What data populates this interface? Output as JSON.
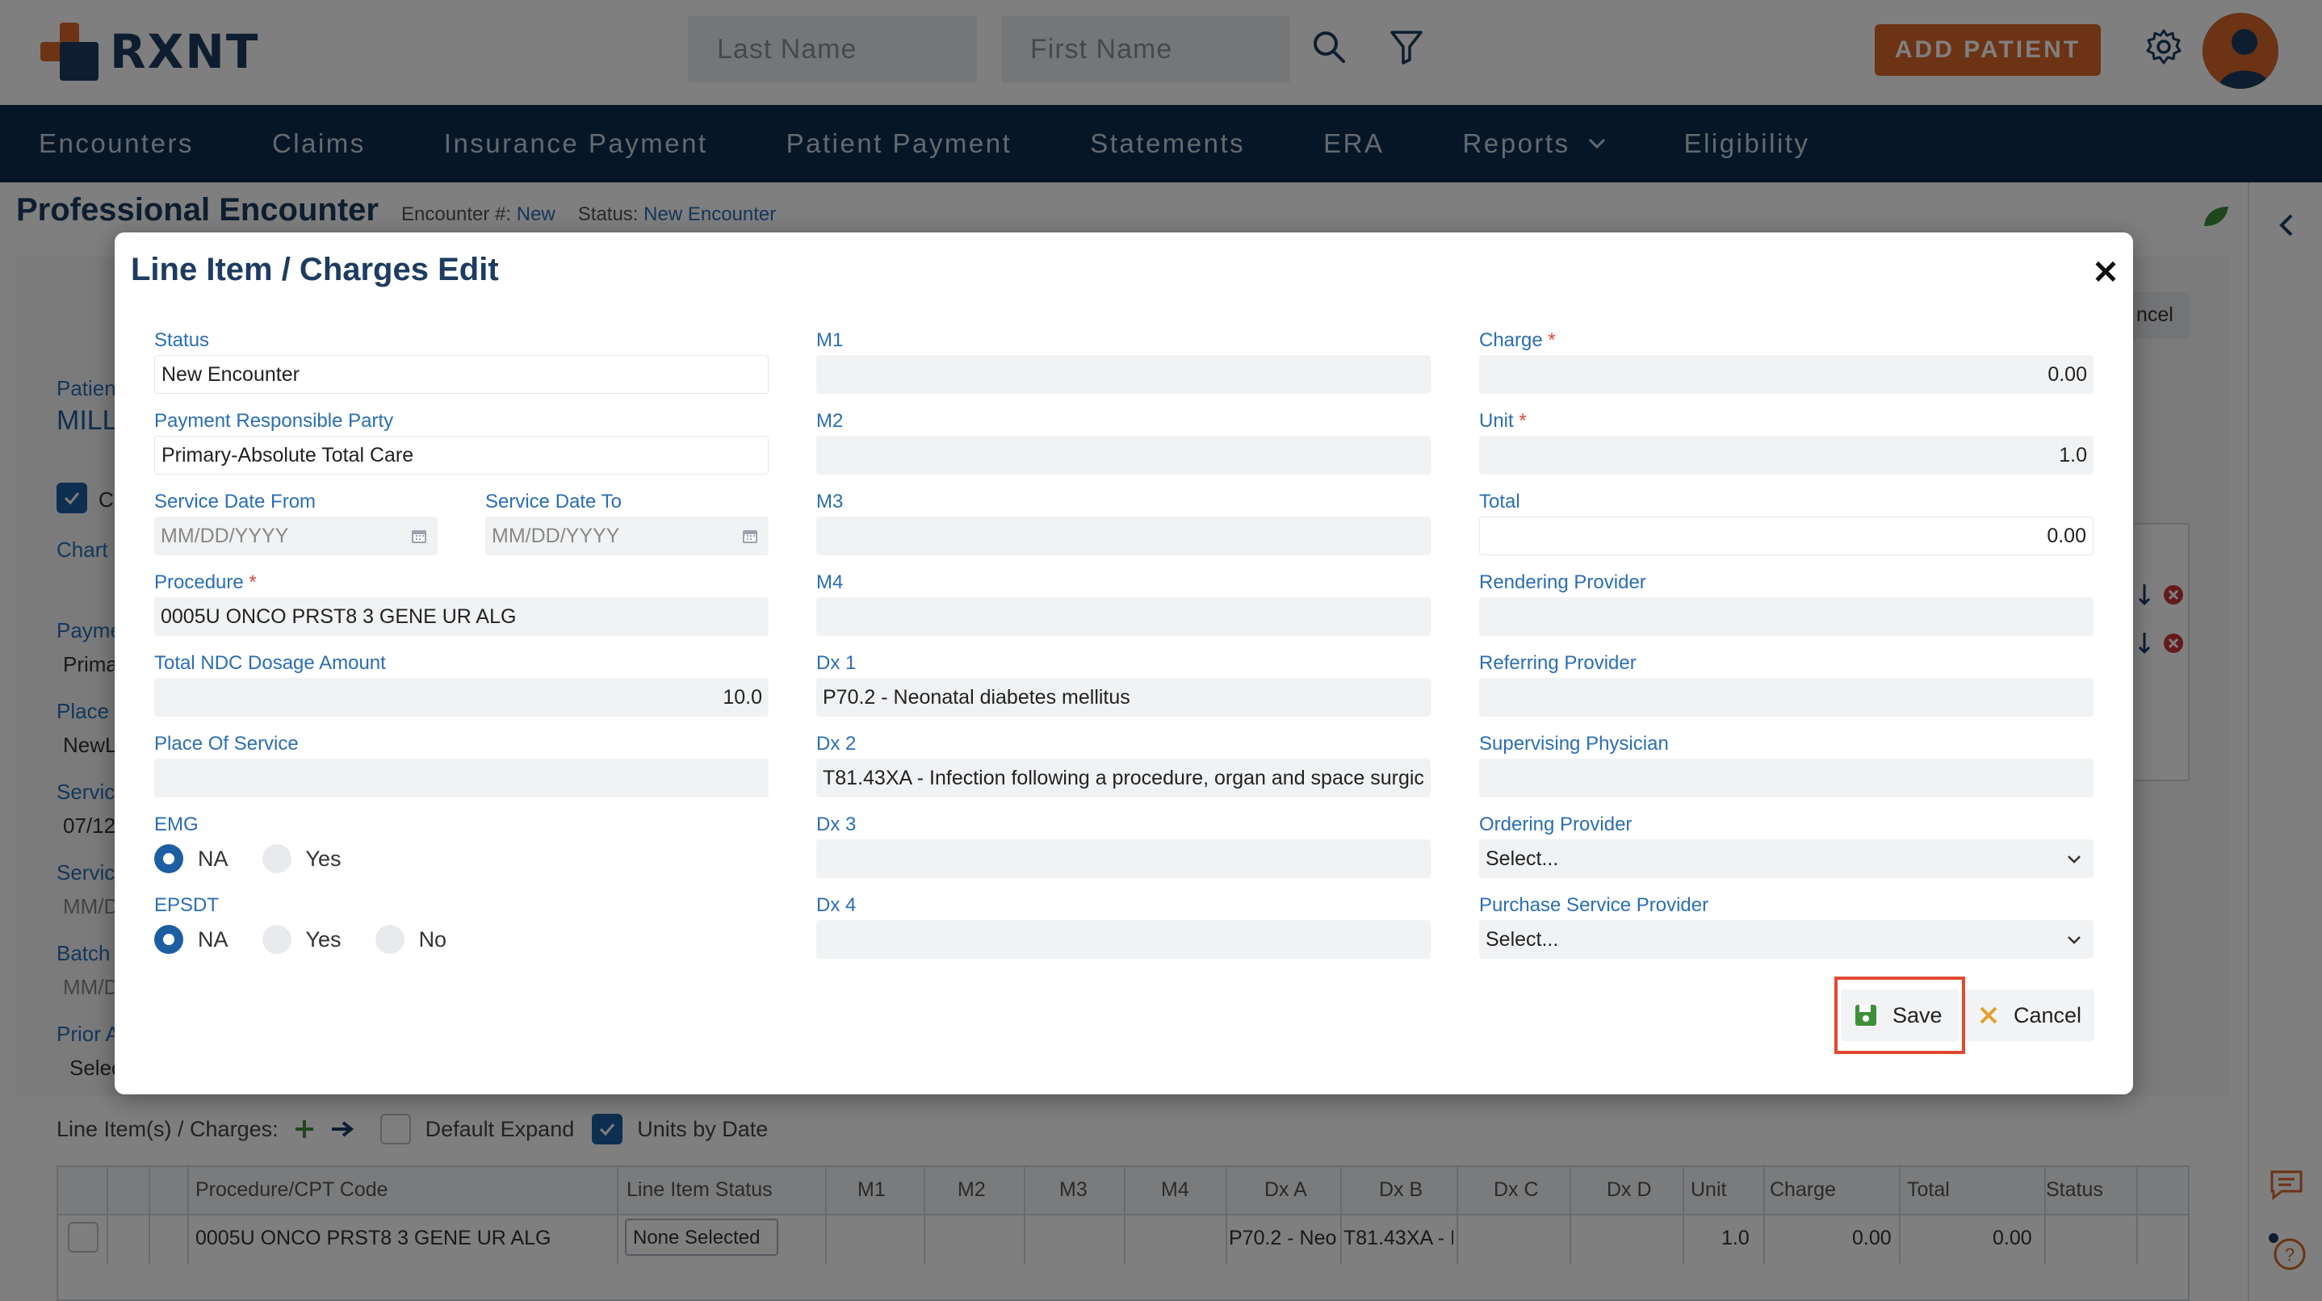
{
  "header": {
    "logo_text": "RXNT",
    "last_name_placeholder": "Last Name",
    "first_name_placeholder": "First Name",
    "add_patient_label": "ADD PATIENT",
    "brand_accent": "#d9662b",
    "brand_navy": "#0f2d4f"
  },
  "nav": {
    "items": [
      "Encounters",
      "Claims",
      "Insurance Payment",
      "Patient Payment",
      "Statements",
      "ERA",
      "Reports",
      "Eligibility"
    ]
  },
  "page": {
    "title": "Professional Encounter",
    "encounter_label": "Encounter #:",
    "encounter_value": "New",
    "status_label": "Status:",
    "status_value": "New Encounter",
    "cancel_label": "ncel",
    "side_fields": {
      "patient_label": "Patien",
      "patient_value": "MILL",
      "chart_label": "Chart",
      "check_label": "C",
      "payment_label": "Payme",
      "payment_value": "Prima",
      "place_label": "Place",
      "place_value": "NewL",
      "service1_label": "Servic",
      "service1_value": "07/12",
      "service2_label": "Servic",
      "service2_value": "MM/D",
      "batch_label": "Batch",
      "batch_value": "MM/D",
      "prior_label": "Prior A",
      "prior_value": "Selec"
    },
    "line_items": {
      "label": "Line Item(s) / Charges:",
      "default_expand": "Default Expand",
      "units_by_date": "Units by Date",
      "columns": [
        "Procedure/CPT Code",
        "Line Item Status",
        "M1",
        "M2",
        "M3",
        "M4",
        "Dx A",
        "Dx B",
        "Dx C",
        "Dx D",
        "Unit",
        "Charge",
        "Total",
        "Status"
      ],
      "row": {
        "procedure": "0005U ONCO PRST8 3 GENE UR ALG",
        "status_select": "None Selected",
        "dx_a": "P70.2 - Neor",
        "dx_b": "T81.43XA - I",
        "unit": "1.0",
        "charge": "0.00",
        "total": "0.00"
      }
    }
  },
  "modal": {
    "title": "Line Item / Charges Edit",
    "col1": {
      "status_label": "Status",
      "status_value": "New Encounter",
      "prp_label": "Payment Responsible Party",
      "prp_value": "Primary-Absolute Total Care",
      "sdf_label": "Service Date From",
      "sdf_placeholder": "MM/DD/YYYY",
      "sdt_label": "Service Date To",
      "sdt_placeholder": "MM/DD/YYYY",
      "procedure_label": "Procedure",
      "procedure_value": "0005U ONCO PRST8 3 GENE UR ALG",
      "ndc_label": "Total NDC Dosage Amount",
      "ndc_value": "10.0",
      "pos_label": "Place Of Service",
      "pos_value": "",
      "emg_label": "EMG",
      "emg_options": [
        "NA",
        "Yes"
      ],
      "epsdt_label": "EPSDT",
      "epsdt_options": [
        "NA",
        "Yes",
        "No"
      ]
    },
    "col2": {
      "m1_label": "M1",
      "m2_label": "M2",
      "m3_label": "M3",
      "m4_label": "M4",
      "dx1_label": "Dx 1",
      "dx1_value": "P70.2 - Neonatal diabetes mellitus",
      "dx2_label": "Dx 2",
      "dx2_value": "T81.43XA - Infection following a procedure, organ and space surgic",
      "dx3_label": "Dx 3",
      "dx4_label": "Dx 4"
    },
    "col3": {
      "charge_label": "Charge",
      "charge_value": "0.00",
      "unit_label": "Unit",
      "unit_value": "1.0",
      "total_label": "Total",
      "total_value": "0.00",
      "rendering_label": "Rendering Provider",
      "referring_label": "Referring Provider",
      "supervising_label": "Supervising Physician",
      "ordering_label": "Ordering Provider",
      "ordering_value": "Select...",
      "purchase_label": "Purchase Service Provider",
      "purchase_value": "Select..."
    },
    "save_label": "Save",
    "cancel_label": "Cancel",
    "required_mark": "*"
  }
}
